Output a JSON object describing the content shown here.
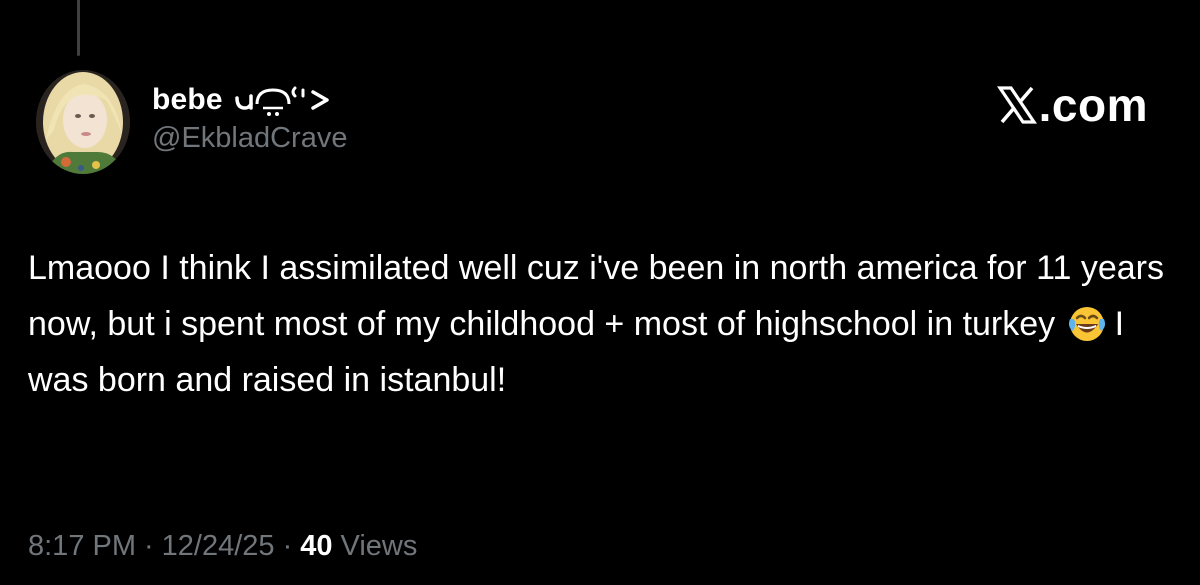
{
  "tweet": {
    "display_name": "bebe",
    "name_emoticon_icon": "cat-kaomoji-icon",
    "handle": "@EkbladCrave",
    "brand_label": ".com",
    "brand_icon": "x-logo-icon",
    "text_part1": "Lmaooo I think I assimilated well cuz i've been in north america for 11 years now, but i spent most of my childhood + most of highschool in turkey",
    "emoji_icon": "face-with-tears-of-joy-emoji",
    "text_part2": "I was born and raised in istanbul!",
    "time": "8:17 PM",
    "date": "12/24/25",
    "separator": "·",
    "views_count": "40",
    "views_label": "Views"
  },
  "colors": {
    "background": "#000000",
    "primary_text": "#ffffff",
    "secondary_text": "#71767b",
    "thread_line": "#3e4144"
  }
}
